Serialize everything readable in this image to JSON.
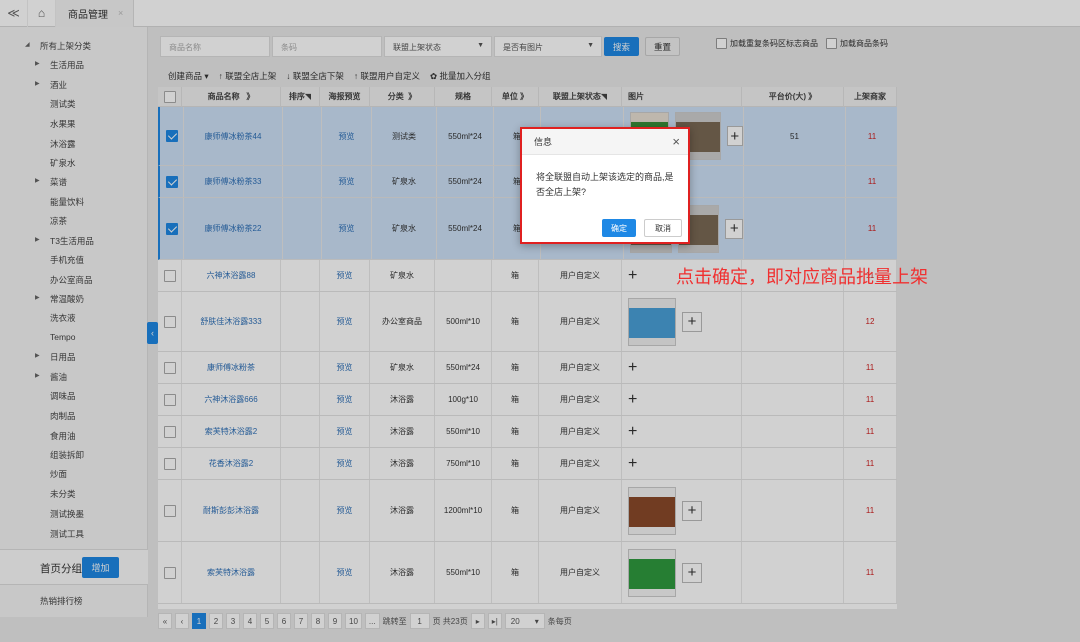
{
  "topbar": {
    "tab_label": "商品管理",
    "tab_close": "×",
    "back_glyph": "≪",
    "home_glyph": "⌂"
  },
  "sidebar": {
    "tree": [
      {
        "label": "所有上架分类",
        "arrow": "◢"
      },
      {
        "label": "生活用品",
        "arrow": "▶"
      },
      {
        "label": "酒业",
        "arrow": "▶"
      },
      {
        "label": "测试类"
      },
      {
        "label": "水果果"
      },
      {
        "label": "沐浴露"
      },
      {
        "label": "矿泉水"
      },
      {
        "label": "菜谱",
        "arrow": "▶"
      },
      {
        "label": "能量饮料"
      },
      {
        "label": "凉茶"
      },
      {
        "label": "T3生活用品",
        "arrow": "▶"
      },
      {
        "label": "手机充值"
      },
      {
        "label": "办公室商品"
      },
      {
        "label": "常温酸奶",
        "arrow": "▶"
      },
      {
        "label": "洗衣液"
      },
      {
        "label": "Tempo"
      },
      {
        "label": "日用品",
        "arrow": "▶"
      },
      {
        "label": "酱油",
        "arrow": "▶"
      },
      {
        "label": "调味品"
      },
      {
        "label": "肉制品"
      },
      {
        "label": "食用油"
      },
      {
        "label": "组装拆卸"
      },
      {
        "label": "炒面"
      },
      {
        "label": "未分类"
      },
      {
        "label": "测试换墨"
      },
      {
        "label": "测试工具"
      }
    ],
    "home_group_label": "首页分组",
    "add_button": "增加",
    "hot_rank": "热销排行榜",
    "collapse_glyph": "‹"
  },
  "filter": {
    "name_placeholder": "商品名称",
    "barcode_placeholder": "条码",
    "status_select": "联盟上架状态",
    "image_select": "是否有图片",
    "search_button": "搜索",
    "reset_button": "重置",
    "chk_dup_barcode": "加载重复条码区标志商品",
    "chk_barcode": "加载商品条码"
  },
  "toolbar": {
    "create": "创建商品 ▾",
    "all_up": "↑ 联盟全店上架",
    "all_down": "↓ 联盟全店下架",
    "custom_up": "↑ 联盟用户自定义",
    "batch_group": "✿ 批量加入分组"
  },
  "columns": {
    "name": "商品名称",
    "name_sort": "》",
    "sort": "排序◥",
    "preview": "海报预览",
    "category": "分类",
    "category_sort": "》",
    "spec": "规格",
    "unit": "单位",
    "unit_sort": "》",
    "status": "联盟上架状态◥",
    "image": "图片",
    "price": "平台价(大)",
    "price_sort": "》",
    "merchants": "上架商家"
  },
  "rows": [
    {
      "name": "康师傅冰粉茶44",
      "preview": "预览",
      "category": "测试类",
      "spec": "550ml*24",
      "unit": "箱",
      "status": "",
      "price": "51",
      "merchants": "11",
      "checked": true
    },
    {
      "name": "康师傅冰粉茶33",
      "preview": "预览",
      "category": "矿泉水",
      "spec": "550ml*24",
      "unit": "箱",
      "status": "",
      "price": "",
      "merchants": "11",
      "checked": true
    },
    {
      "name": "康师傅冰粉茶22",
      "preview": "预览",
      "category": "矿泉水",
      "spec": "550ml*24",
      "unit": "箱",
      "status": "",
      "price": "",
      "merchants": "11",
      "checked": true
    },
    {
      "name": "六神沐浴露88",
      "preview": "预览",
      "category": "矿泉水",
      "spec": "",
      "unit": "箱",
      "status": "用户自定义",
      "price": "",
      "merchants": "11",
      "checked": false
    },
    {
      "name": "舒肤佳沐浴露333",
      "preview": "预览",
      "category": "办公室商品",
      "spec": "500ml*10",
      "unit": "箱",
      "status": "用户自定义",
      "price": "",
      "merchants": "12",
      "checked": false
    },
    {
      "name": "康师傅冰粉茶",
      "preview": "预览",
      "category": "矿泉水",
      "spec": "550ml*24",
      "unit": "箱",
      "status": "用户自定义",
      "price": "",
      "merchants": "11",
      "checked": false
    },
    {
      "name": "六神沐浴露666",
      "preview": "预览",
      "category": "沐浴露",
      "spec": "100g*10",
      "unit": "箱",
      "status": "用户自定义",
      "price": "",
      "merchants": "11",
      "checked": false
    },
    {
      "name": "索芙特沐浴露2",
      "preview": "预览",
      "category": "沐浴露",
      "spec": "550ml*10",
      "unit": "箱",
      "status": "用户自定义",
      "price": "",
      "merchants": "11",
      "checked": false
    },
    {
      "name": "花香沐浴露2",
      "preview": "预览",
      "category": "沐浴露",
      "spec": "750ml*10",
      "unit": "箱",
      "status": "用户自定义",
      "price": "",
      "merchants": "11",
      "checked": false
    },
    {
      "name": "耐斯彭彭沐浴露",
      "preview": "预览",
      "category": "沐浴露",
      "spec": "1200ml*10",
      "unit": "箱",
      "status": "用户自定义",
      "price": "",
      "merchants": "11",
      "checked": false
    },
    {
      "name": "索芙特沐浴露",
      "preview": "预览",
      "category": "沐浴露",
      "spec": "550ml*10",
      "unit": "箱",
      "status": "用户自定义",
      "price": "",
      "merchants": "11",
      "checked": false
    }
  ],
  "pager": {
    "pages": [
      "1",
      "2",
      "3",
      "4",
      "5",
      "6",
      "7",
      "8",
      "9",
      "10",
      "..."
    ],
    "goto_label": "跳转至",
    "goto_value": "1",
    "total_label": "页 共23页",
    "page_size": "20",
    "per_page": "条每页"
  },
  "dialog": {
    "title": "信息",
    "message": "将全联盟自动上架该选定的商品,是否全店上架?",
    "ok": "确定",
    "cancel": "取消"
  },
  "annotation": "点击确定，即对应商品批量上架",
  "colors": {
    "accent": "#1e88e5",
    "annotation": "#f03030",
    "selected_row": "#cde1f7"
  }
}
